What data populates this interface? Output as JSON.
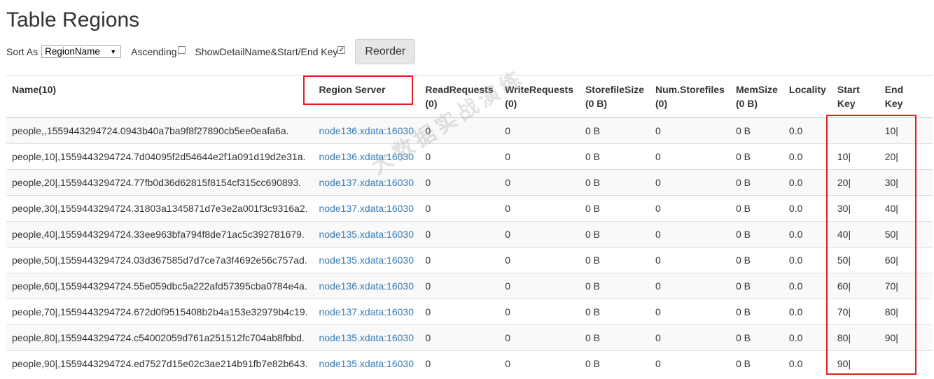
{
  "title": "Table Regions",
  "controls": {
    "sort_label": "Sort As",
    "sort_value": "RegionName",
    "ascending_label": "Ascending",
    "ascending_checked": false,
    "show_detail_label": "ShowDetailName&Start/End Key",
    "show_detail_checked": true,
    "reorder_label": "Reorder"
  },
  "table": {
    "headers": [
      {
        "line1": "Name(10)",
        "line2": ""
      },
      {
        "line1": "Region Server",
        "line2": ""
      },
      {
        "line1": "ReadRequests",
        "line2": "(0)"
      },
      {
        "line1": "WriteRequests",
        "line2": "(0)"
      },
      {
        "line1": "StorefileSize",
        "line2": "(0 B)"
      },
      {
        "line1": "Num.Storefiles",
        "line2": "(0)"
      },
      {
        "line1": "MemSize",
        "line2": "(0 B)"
      },
      {
        "line1": "Locality",
        "line2": ""
      },
      {
        "line1": "Start",
        "line2": "Key"
      },
      {
        "line1": "End",
        "line2": "Key"
      }
    ],
    "rows": [
      {
        "name": "people,,1559443294724.0943b40a7ba9f8f27890cb5ee0eafa6a.",
        "server": "node136.xdata:16030",
        "read": "0",
        "write": "0",
        "storefile_size": "0 B",
        "num_storefiles": "0",
        "memsize": "0 B",
        "locality": "0.0",
        "start_key": "",
        "end_key": "10|"
      },
      {
        "name": "people,10|,1559443294724.7d04095f2d54644e2f1a091d19d2e31a.",
        "server": "node136.xdata:16030",
        "read": "0",
        "write": "0",
        "storefile_size": "0 B",
        "num_storefiles": "0",
        "memsize": "0 B",
        "locality": "0.0",
        "start_key": "10|",
        "end_key": "20|"
      },
      {
        "name": "people,20|,1559443294724.77fb0d36d62815f8154cf315cc690893.",
        "server": "node137.xdata:16030",
        "read": "0",
        "write": "0",
        "storefile_size": "0 B",
        "num_storefiles": "0",
        "memsize": "0 B",
        "locality": "0.0",
        "start_key": "20|",
        "end_key": "30|"
      },
      {
        "name": "people,30|,1559443294724.31803a1345871d7e3e2a001f3c9316a2.",
        "server": "node137.xdata:16030",
        "read": "0",
        "write": "0",
        "storefile_size": "0 B",
        "num_storefiles": "0",
        "memsize": "0 B",
        "locality": "0.0",
        "start_key": "30|",
        "end_key": "40|"
      },
      {
        "name": "people,40|,1559443294724.33ee963bfa794f8de71ac5c392781679.",
        "server": "node135.xdata:16030",
        "read": "0",
        "write": "0",
        "storefile_size": "0 B",
        "num_storefiles": "0",
        "memsize": "0 B",
        "locality": "0.0",
        "start_key": "40|",
        "end_key": "50|"
      },
      {
        "name": "people,50|,1559443294724.03d367585d7d7ce7a3f4692e56c757ad.",
        "server": "node135.xdata:16030",
        "read": "0",
        "write": "0",
        "storefile_size": "0 B",
        "num_storefiles": "0",
        "memsize": "0 B",
        "locality": "0.0",
        "start_key": "50|",
        "end_key": "60|"
      },
      {
        "name": "people,60|,1559443294724.55e059dbc5a222afd57395cba0784e4a.",
        "server": "node136.xdata:16030",
        "read": "0",
        "write": "0",
        "storefile_size": "0 B",
        "num_storefiles": "0",
        "memsize": "0 B",
        "locality": "0.0",
        "start_key": "60|",
        "end_key": "70|"
      },
      {
        "name": "people,70|,1559443294724.672d0f9515408b2b4a153e32979b4c19.",
        "server": "node137.xdata:16030",
        "read": "0",
        "write": "0",
        "storefile_size": "0 B",
        "num_storefiles": "0",
        "memsize": "0 B",
        "locality": "0.0",
        "start_key": "70|",
        "end_key": "80|"
      },
      {
        "name": "people,80|,1559443294724.c54002059d761a251512fc704ab8fbbd.",
        "server": "node135.xdata:16030",
        "read": "0",
        "write": "0",
        "storefile_size": "0 B",
        "num_storefiles": "0",
        "memsize": "0 B",
        "locality": "0.0",
        "start_key": "80|",
        "end_key": "90|"
      },
      {
        "name": "people,90|,1559443294724.ed7527d15e02c3ae214b91fb7e82b643.",
        "server": "node135.xdata:16030",
        "read": "0",
        "write": "0",
        "storefile_size": "0 B",
        "num_storefiles": "0",
        "memsize": "0 B",
        "locality": "0.0",
        "start_key": "90|",
        "end_key": ""
      }
    ]
  },
  "watermark": "大数据实战演练",
  "colors": {
    "link": "#337ab7",
    "highlight": "#e02020",
    "stripe": "#f9f9f9",
    "border": "#dddddd"
  }
}
